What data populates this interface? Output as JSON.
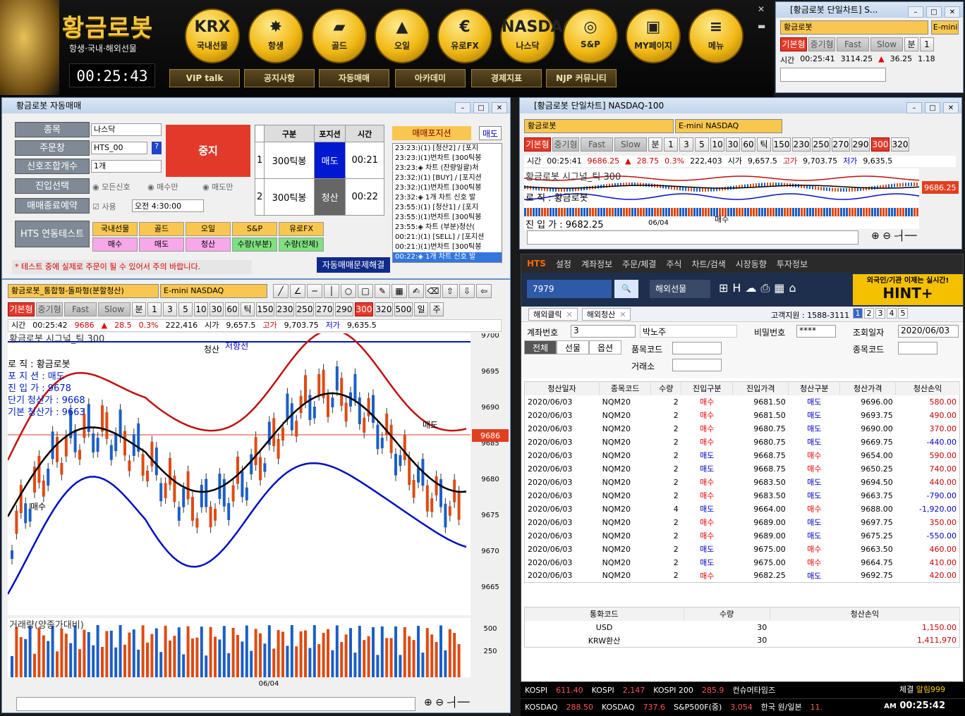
{
  "banner": {
    "logo": "황금로봇",
    "sub": "항생·국내·해외선물",
    "clock": "00:25:43",
    "circles": [
      {
        "icon": "KRX",
        "label": "국내선물"
      },
      {
        "icon": "✸",
        "label": "항생"
      },
      {
        "icon": "▰",
        "label": "골드"
      },
      {
        "icon": "▲",
        "label": "오일"
      },
      {
        "icon": "€",
        "label": "유로FX"
      },
      {
        "icon": "NASDAQ",
        "label": "나스닥"
      },
      {
        "icon": "◎",
        "label": "S&P"
      },
      {
        "icon": "▣",
        "label": "MY페이지"
      },
      {
        "icon": "≡",
        "label": "메뉴"
      }
    ],
    "subs": [
      "VIP talk",
      "공지사항",
      "자동매매",
      "아카데미",
      "경제지표",
      "NJP 커뮤니티"
    ]
  },
  "mini_chart": {
    "title": "[황금로봇 단일차트] S...",
    "combo": "황금로봇",
    "product": "E-mini",
    "btns": [
      "기본형",
      "중기형",
      "Fast",
      "Slow",
      "분",
      "1"
    ],
    "time_label": "시간",
    "time": "00:25:41",
    "price": "3114.25",
    "change": "36.25",
    "pct": "1.18"
  },
  "auto": {
    "title": "황금로봇 자동매매",
    "labels": [
      "종목",
      "주문창",
      "신호조합개수",
      "진입선택",
      "매매종료예약",
      "HTS 연동테스트"
    ],
    "item": "나스닥",
    "account": "HTS_00",
    "count": "1개",
    "stop": "중지",
    "entry_opts": [
      "모든신호",
      "매수만",
      "매도만"
    ],
    "use": "사용",
    "endtime": "오전 4:30:00",
    "head": [
      "구분",
      "포지션",
      "시간"
    ],
    "rows": [
      {
        "n": "1",
        "type": "300틱봉",
        "pos": "매도",
        "time": "00:21"
      },
      {
        "n": "2",
        "type": "300틱봉",
        "pos": "청산",
        "time": "00:22"
      }
    ],
    "test1": [
      "국내선물",
      "골드",
      "오일",
      "S&P",
      "유로FX"
    ],
    "test2": [
      "매수",
      "매도",
      "청산",
      "수량(부분)",
      "수량(전체)"
    ],
    "warn": "* 테스트 중에 실제로 주문이 될 수 있어서 주의 바랍니다.",
    "solve": "자동매매문제해결",
    "pos_label": "매매포지션",
    "pos_value": "매도",
    "log": [
      "23:23:)(1) [청산2] / [포지",
      "23:23:)(1)번차트 [300틱봉",
      "23:23:◈ 차트 (잔량일괄)처",
      "23:32:)(1) [BUY] / [포지션",
      "23:32:)(1)번차트 [300틱봉",
      "23:32:◈ 1개 차트 신호 발",
      "23:55:)(1) [청산1] / [포지",
      "23:55:)(1)번차트 [300틱봉",
      "23:55:◈ 차트 (부분)청산(",
      "00:21:)(1) [SELL] / [포지션",
      "00:21:)(1)번차트 [300틱봉",
      "00:22:◈ 1개 차트 신호 발"
    ]
  },
  "main_chart": {
    "combo": "황금로봇_통합형-돌파형(분할청산)",
    "product": "E-mini NASDAQ",
    "btns": [
      "기본형",
      "중기형",
      "Fast",
      "Slow",
      "분",
      "1",
      "3",
      "5",
      "10",
      "30",
      "60",
      "틱",
      "150",
      "230",
      "250",
      "270",
      "290",
      "300",
      "320",
      "500",
      "일",
      "주"
    ],
    "info": [
      "시간",
      "00:25:42",
      "9686",
      "28.5",
      "0.3%",
      "222,416",
      "시가",
      "9,657.5",
      "고가",
      "9,703.75",
      "저가",
      "9,635.5"
    ],
    "signal": "황금로봇 시그널_틱 300",
    "legend": [
      "로      직 : 황금로봇",
      "포  지  션 : 매도",
      "진  입  가 : 9678",
      "단기 청산가 : 9668",
      "기본 청산가 : 9663"
    ],
    "marks": {
      "clear": "청산",
      "resist": "저항선",
      "buy": "매수",
      "sell": "매도"
    },
    "yticks": [
      "9700",
      "9695",
      "9690",
      "9685",
      "9680",
      "9675",
      "9670",
      "9665"
    ],
    "last": "9686",
    "vol_title": "거래량(양종가대비)",
    "vol_ticks": [
      "500",
      "250"
    ],
    "date": "06/04"
  },
  "nasdaq": {
    "title": "[황금로봇 단일차트] NASDAQ-100",
    "combo": "황금로봇",
    "product": "E-mini NASDAQ",
    "btns": [
      "기본형",
      "중기형",
      "Fast",
      "Slow",
      "분",
      "1",
      "3",
      "5",
      "10",
      "30",
      "60",
      "틱",
      "150",
      "230",
      "250",
      "270",
      "290",
      "300",
      "320"
    ],
    "info": [
      "시간",
      "00:25:41",
      "9686.25",
      "28.75",
      "0.3%",
      "222,403",
      "시가",
      "9,657.5",
      "고가",
      "9,703.75",
      "저가",
      "9,635.5"
    ],
    "signal": "황금로봇 시그널_틱 300",
    "logic": "로     직 : 황금로봇",
    "entry": "진  입  가 : 9682.25",
    "last": "9686.25",
    "date": "06/04",
    "sell": "매수"
  },
  "hts": {
    "brand": "HTS",
    "menu": [
      "설정",
      "계좌정보",
      "주문/체결",
      "주식",
      "차트/검색",
      "시장동향",
      "투자정보"
    ],
    "code": "7979",
    "market": "해외선물",
    "ad1": "외국인/기관 이제는 실시간!",
    "ad2": "HINT+",
    "tabs": [
      "해외클릭",
      "해외청산"
    ],
    "support": "고객지원 : 1588-3111",
    "pages": [
      "1",
      "2",
      "3",
      "4",
      "5"
    ],
    "acc_label": "계좌번호",
    "acc": "3",
    "name": "박노주",
    "pw_label": "비밀번호",
    "pw": "****",
    "date_label": "조회일자",
    "date": "2020/06/03",
    "filters": [
      "전체",
      "선물",
      "옵션"
    ],
    "item_label": "품목코드",
    "item2_label": "종목코드",
    "ex_label": "거래소",
    "cols": [
      "청산일자",
      "종목코드",
      "수량",
      "진입구분",
      "진입가격",
      "청산구분",
      "청산가격",
      "청산손익"
    ],
    "rows": [
      [
        "2020/06/03",
        "NQM20",
        "2",
        "매수",
        "9681.50",
        "매도",
        "9696.00",
        "580.00"
      ],
      [
        "2020/06/03",
        "NQM20",
        "2",
        "매수",
        "9681.50",
        "매도",
        "9693.75",
        "490.00"
      ],
      [
        "2020/06/03",
        "NQM20",
        "2",
        "매수",
        "9680.75",
        "매도",
        "9690.00",
        "370.00"
      ],
      [
        "2020/06/03",
        "NQM20",
        "2",
        "매수",
        "9680.75",
        "매도",
        "9669.75",
        "-440.00"
      ],
      [
        "2020/06/03",
        "NQM20",
        "2",
        "매도",
        "9668.75",
        "매수",
        "9654.00",
        "590.00"
      ],
      [
        "2020/06/03",
        "NQM20",
        "2",
        "매도",
        "9668.75",
        "매수",
        "9650.25",
        "740.00"
      ],
      [
        "2020/06/03",
        "NQM20",
        "2",
        "매수",
        "9683.50",
        "매도",
        "9694.50",
        "440.00"
      ],
      [
        "2020/06/03",
        "NQM20",
        "2",
        "매수",
        "9683.50",
        "매도",
        "9663.75",
        "-790.00"
      ],
      [
        "2020/06/03",
        "NQM20",
        "4",
        "매도",
        "9664.00",
        "매수",
        "9688.00",
        "-1,920.00"
      ],
      [
        "2020/06/03",
        "NQM20",
        "2",
        "매수",
        "9689.00",
        "매도",
        "9697.75",
        "350.00"
      ],
      [
        "2020/06/03",
        "NQM20",
        "2",
        "매수",
        "9689.00",
        "매도",
        "9675.25",
        "-550.00"
      ],
      [
        "2020/06/03",
        "NQM20",
        "2",
        "매도",
        "9675.00",
        "매수",
        "9663.50",
        "460.00"
      ],
      [
        "2020/06/03",
        "NQM20",
        "2",
        "매도",
        "9675.00",
        "매수",
        "9664.75",
        "410.00"
      ],
      [
        "2020/06/03",
        "NQM20",
        "2",
        "매수",
        "9682.25",
        "매도",
        "9692.75",
        "420.00"
      ]
    ],
    "sum_cols": [
      "통화코드",
      "수량",
      "청산손익"
    ],
    "sums": [
      [
        "USD",
        "30",
        "1,150.00"
      ],
      [
        "KRW환산",
        "30",
        "1,411,970"
      ]
    ]
  },
  "ticker": {
    "r1": [
      "KOSPI",
      "611.40",
      "KOSPI",
      "2,147",
      "KOSPI 200",
      "285.9",
      "컨슈머타임즈"
    ],
    "r2": [
      "KOSDAQ",
      "288.50",
      "KOSDAQ",
      "737.6",
      "S&P500F(중)",
      "3,054",
      "한국 원/일본",
      "11."
    ],
    "right": [
      "체결",
      "알림999"
    ],
    "ampm": "AM",
    "time": "00:25:42"
  }
}
